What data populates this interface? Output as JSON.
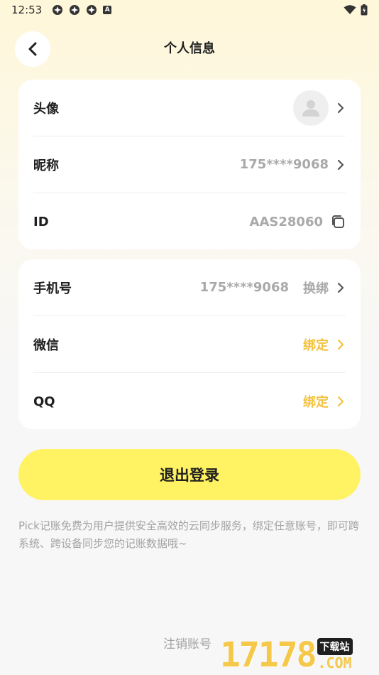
{
  "status_bar": {
    "time": "12:53",
    "icons": [
      "app-notification-icon",
      "app-notification-icon",
      "app-notification-icon",
      "a-badge-icon",
      "wifi-icon",
      "battery-icon"
    ],
    "badge_letter": "A"
  },
  "nav": {
    "title": "个人信息",
    "back_icon": "chevron-left-icon"
  },
  "profile": {
    "avatar_label": "头像",
    "nickname_label": "昵称",
    "nickname_value": "175****9068",
    "id_label": "ID",
    "id_value": "AAS28060"
  },
  "bindings": {
    "phone_label": "手机号",
    "phone_value": "175****9068",
    "phone_action": "换绑",
    "wechat_label": "微信",
    "wechat_action": "绑定",
    "qq_label": "QQ",
    "qq_action": "绑定"
  },
  "logout_label": "退出登录",
  "description": "Pick记账免费为用户提供安全高效的云同步服务，绑定任意账号，即可跨系统、跨设备同步您的记账数据哦~",
  "cancel_account_label": "注销账号",
  "watermark": {
    "number": "17178",
    "site": "下载站",
    "domain": ".COM"
  },
  "colors": {
    "accent_yellow": "#FFF263",
    "bind_text": "#F3C23F",
    "muted_text": "#A9A9A9"
  }
}
